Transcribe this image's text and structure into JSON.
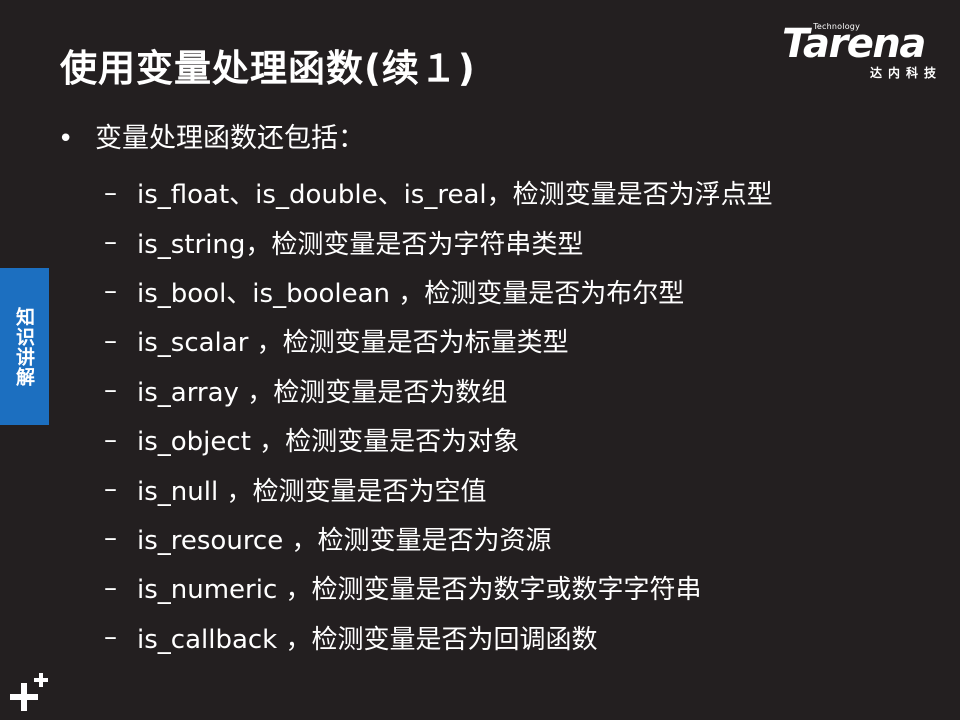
{
  "slide": {
    "title": "使用变量处理函数(续１)",
    "logo": {
      "tag": "Technology",
      "word": "Tarena",
      "cn": "达内科技"
    },
    "side_tab": "知识讲解",
    "bullet": "变量处理函数还包括：",
    "sub_items": [
      "is_float、is_double、is_real，检测变量是否为浮点型",
      "is_string，检测变量是否为字符串类型",
      "is_bool、is_boolean ，检测变量是否为布尔型",
      "is_scalar ，检测变量是否为标量类型",
      "is_array ，检测变量是否为数组",
      "is_object ，检测变量是否为对象",
      "is_null ，检测变量是否为空值",
      "is_resource ，检测变量是否为资源",
      "is_numeric ，检测变量是否为数字或数字字符串",
      "is_callback ，检测变量是否为回调函数"
    ],
    "colors": {
      "background": "#231f20",
      "side_tab": "#1c6fc0",
      "text": "#ffffff"
    }
  }
}
